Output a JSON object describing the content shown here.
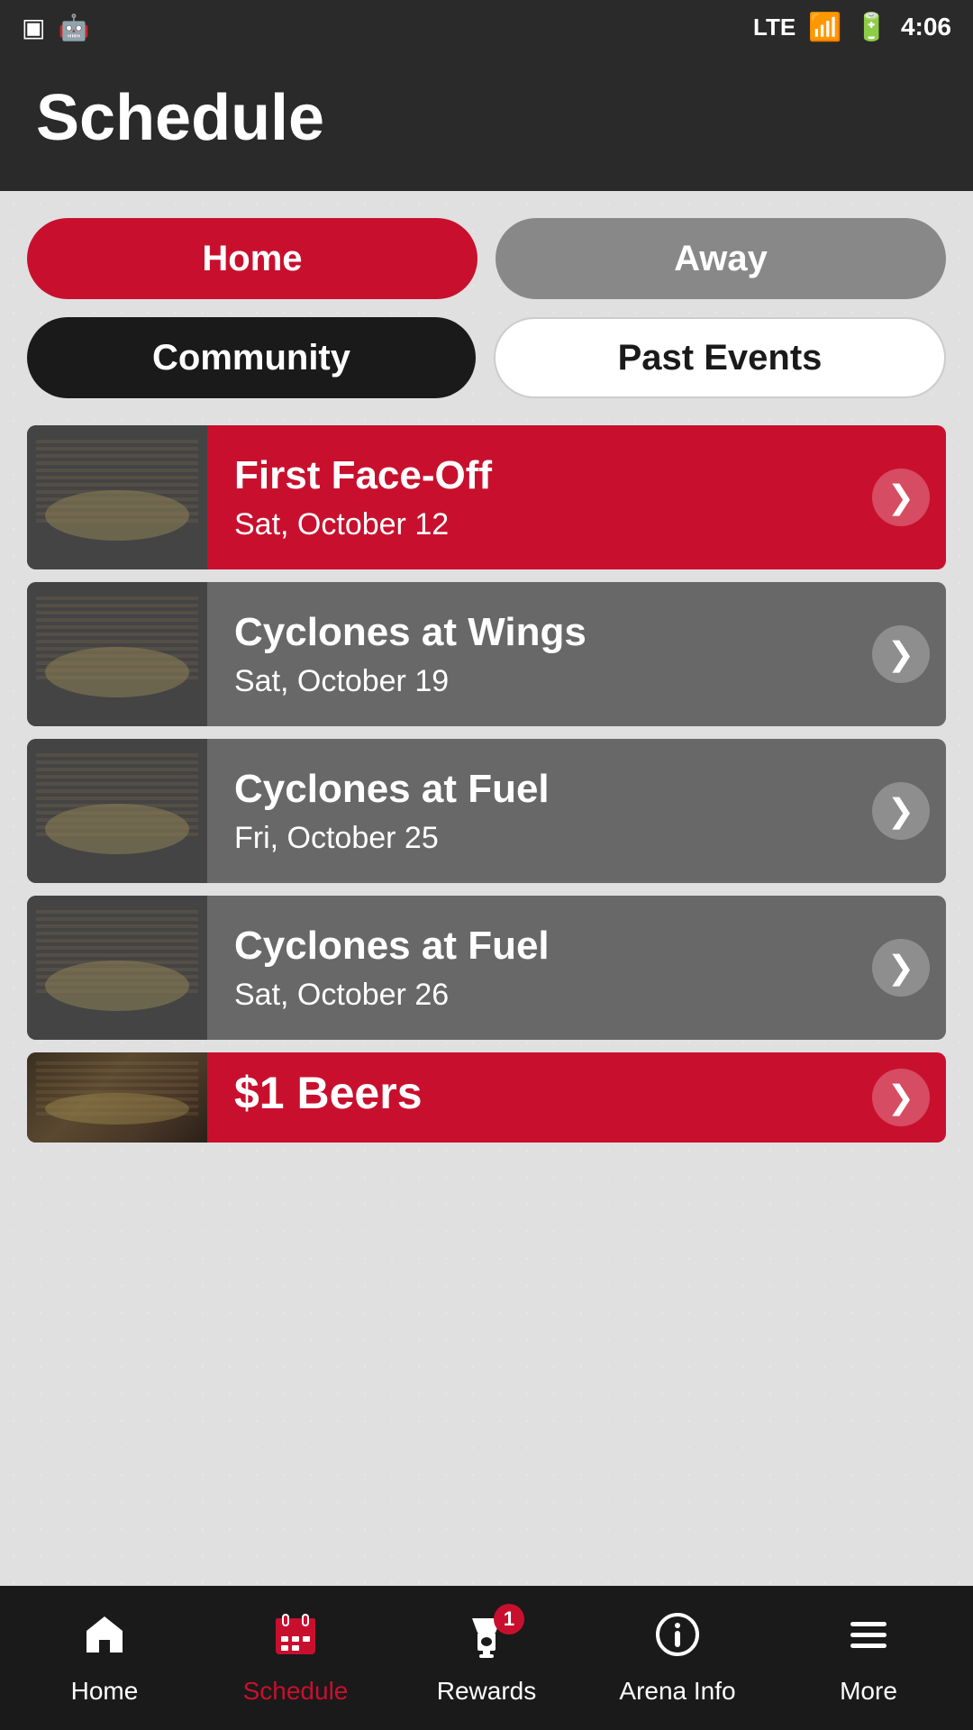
{
  "statusBar": {
    "time": "4:06",
    "signal": "LTE"
  },
  "header": {
    "title": "Schedule"
  },
  "filters": {
    "row1": [
      {
        "id": "home",
        "label": "Home",
        "state": "active-red"
      },
      {
        "id": "away",
        "label": "Away",
        "state": "inactive-gray"
      }
    ],
    "row2": [
      {
        "id": "community",
        "label": "Community",
        "state": "active-black"
      },
      {
        "id": "past-events",
        "label": "Past Events",
        "state": "inactive-white"
      }
    ]
  },
  "events": [
    {
      "id": "event-1",
      "title": "First Face-Off",
      "date": "Sat, October 12",
      "color": "red",
      "partial": false
    },
    {
      "id": "event-2",
      "title": "Cyclones at Wings",
      "date": "Sat, October 19",
      "color": "gray",
      "partial": false
    },
    {
      "id": "event-3",
      "title": "Cyclones at Fuel",
      "date": "Fri, October 25",
      "color": "gray",
      "partial": false
    },
    {
      "id": "event-4",
      "title": "Cyclones at Fuel",
      "date": "Sat, October 26",
      "color": "gray",
      "partial": false
    },
    {
      "id": "event-5",
      "title": "$1 Beers",
      "date": "",
      "color": "red",
      "partial": true
    }
  ],
  "bottomNav": {
    "items": [
      {
        "id": "home",
        "label": "Home",
        "icon": "⌂",
        "active": false
      },
      {
        "id": "schedule",
        "label": "Schedule",
        "icon": "▦",
        "active": true
      },
      {
        "id": "rewards",
        "label": "Rewards",
        "icon": "🏆",
        "active": false,
        "badge": "1"
      },
      {
        "id": "arena-info",
        "label": "Arena Info",
        "icon": "ℹ",
        "active": false
      },
      {
        "id": "more",
        "label": "More",
        "icon": "≡",
        "active": false
      }
    ]
  }
}
